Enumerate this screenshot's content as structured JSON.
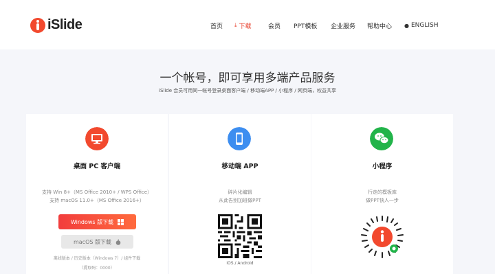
{
  "header": {
    "brand": "iSlide",
    "nav": [
      "首页",
      "下载",
      "会员",
      "PPT模板",
      "企业服务",
      "帮助中心",
      "ENGLISH"
    ]
  },
  "hero": {
    "title": "一个帐号，即可享用多端产品服务",
    "subtitle": "iSlide 会员可用同一帐号登录桌面客户端 / 移动端APP / 小程序 / 网页端，权益共享"
  },
  "cards": [
    {
      "title": "桌面 PC 客户端",
      "lines": [
        "支持 Win 8+（MS Office 2010+ / WPS Office）",
        "支持 macOS 11.0+（MS Office 2016+）"
      ],
      "btn_win": "Windows 版下载",
      "btn_mac": "macOS 版下载",
      "footer": "离线版本 / 历史版本（Windows 7）/ 组件下载",
      "footer2": "（提取码：0000）"
    },
    {
      "title": "移动端 APP",
      "lines": [
        "碎片化编辑",
        "从此告别加班做PPT"
      ],
      "caption": "iOS / Android"
    },
    {
      "title": "小程序",
      "lines": [
        "行走的模板库",
        "做PPT快人一步"
      ]
    }
  ],
  "colors": {
    "accent": "#e8412f",
    "pc_icon": "#f2492e",
    "app_icon": "#3d8ef0",
    "wechat_icon": "#22b44a"
  }
}
